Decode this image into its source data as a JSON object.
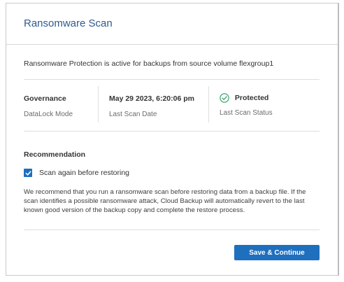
{
  "dialog": {
    "title": "Ransomware Scan",
    "status_line": "Ransomware Protection is active for backups from source volume flexgroup1"
  },
  "summary": {
    "governance": {
      "value": "Governance",
      "label": "DataLock Mode"
    },
    "last_scan": {
      "value": "May 29 2023, 6:20:06 pm",
      "label": "Last Scan Date"
    },
    "scan_status": {
      "value": "Protected",
      "label": "Last Scan Status",
      "icon": "check-circle-icon",
      "color": "#3aa56a"
    }
  },
  "recommendation": {
    "title": "Recommendation",
    "checkbox_label": "Scan again before restoring",
    "checked": true,
    "description": "We recommend that you run a ransomware scan before restoring data from a backup file. If the scan identifies a possible ransomware attack, Cloud Backup will automatically revert to the last known good version of the backup copy and complete the restore process."
  },
  "actions": {
    "save_label": "Save & Continue"
  },
  "colors": {
    "accent": "#1f6fbf",
    "title": "#2f5a8f",
    "success": "#3aa56a"
  }
}
